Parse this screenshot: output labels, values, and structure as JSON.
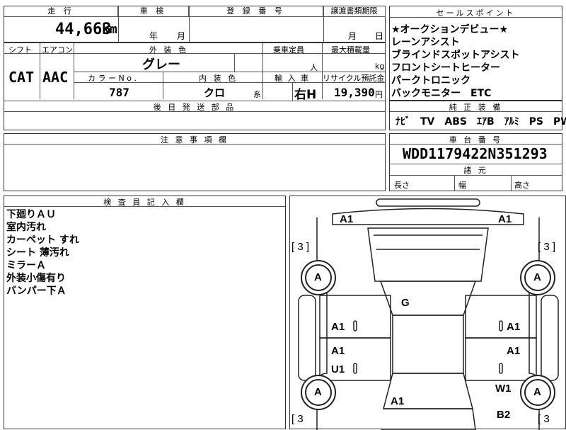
{
  "header": {
    "mileage_label": "走 行",
    "inspection_label": "車 検",
    "registration_label": "登 録 番 号",
    "transfer_label": "譲渡書類期限",
    "sales_point_label": "セールスポイント",
    "mileage_value": "44,663",
    "mileage_unit": "km",
    "year_unit": "年",
    "month_unit": "月",
    "day_unit": "日",
    "month_unit2": "月"
  },
  "specs": {
    "shift_label": "シフト",
    "aircon_label": "エアコン",
    "color_label": "外 装 色",
    "capacity_label": "乗車定員",
    "max_load_label": "最大積載量",
    "shift_value": "CAT",
    "aircon_value": "AAC",
    "color_value": "グレー",
    "person_unit": "人",
    "kg_unit": "kg",
    "color_no_label": "カ ラ ー  N o .",
    "interior_label": "内 装 色",
    "import_label": "輸 入 車",
    "recycle_label": "リサイクル預託金",
    "color_no_value": "787",
    "interior_value": "クロ",
    "interior_suffix": "系",
    "import_value": "右H",
    "recycle_value": "19,390",
    "yen_unit": "円",
    "later_parts_label": "後 日 発 送 部 品"
  },
  "sales_points": [
    "★オークションデビュー★",
    "レーンアシスト",
    "ブラインドスポットアシスト",
    "フロントシートヒーター",
    "パークトロニック",
    "バックモニター　ETC"
  ],
  "equipment": {
    "label": "純 正 装 備",
    "value": "ﾅﾋﾞ　TV　ABS　ｴｱB　ｱﾙﾐ　PS　PW"
  },
  "caution": {
    "label": "注 意 事 項 欄"
  },
  "chassis": {
    "label": "車 台 番 号",
    "value": "WDD1179422N351293",
    "dims_label": "諸 元",
    "length_label": "長さ",
    "width_label": "幅",
    "height_label": "高さ"
  },
  "inspector": {
    "label": "検 査 員 記 入 欄",
    "notes": [
      "下廻りＡＵ",
      "室内汚れ",
      "カーペット すれ",
      "シート 薄汚れ",
      "ミラーＡ",
      "外装小傷有り",
      "バンパー下Ａ"
    ]
  },
  "diagram": {
    "front_left": "A1",
    "front_right": "A1",
    "tire_fl_bracket": "[ 3 ]",
    "tire_fr_bracket": "[ 3 ]",
    "tire_rl_bracket": "[ 3",
    "tire_rr_bracket": "[ 3",
    "wheel_fl": "A",
    "wheel_fr": "A",
    "wheel_rl": "A",
    "wheel_rr": "A",
    "glass": "G",
    "door_fl": "A1",
    "door_fr": "A1",
    "door_rl": "A1",
    "door_rl2": "U1",
    "door_rr": "A1",
    "rear_right": "W1",
    "rear_center": "A1",
    "rear_bottom_right": "B2"
  }
}
